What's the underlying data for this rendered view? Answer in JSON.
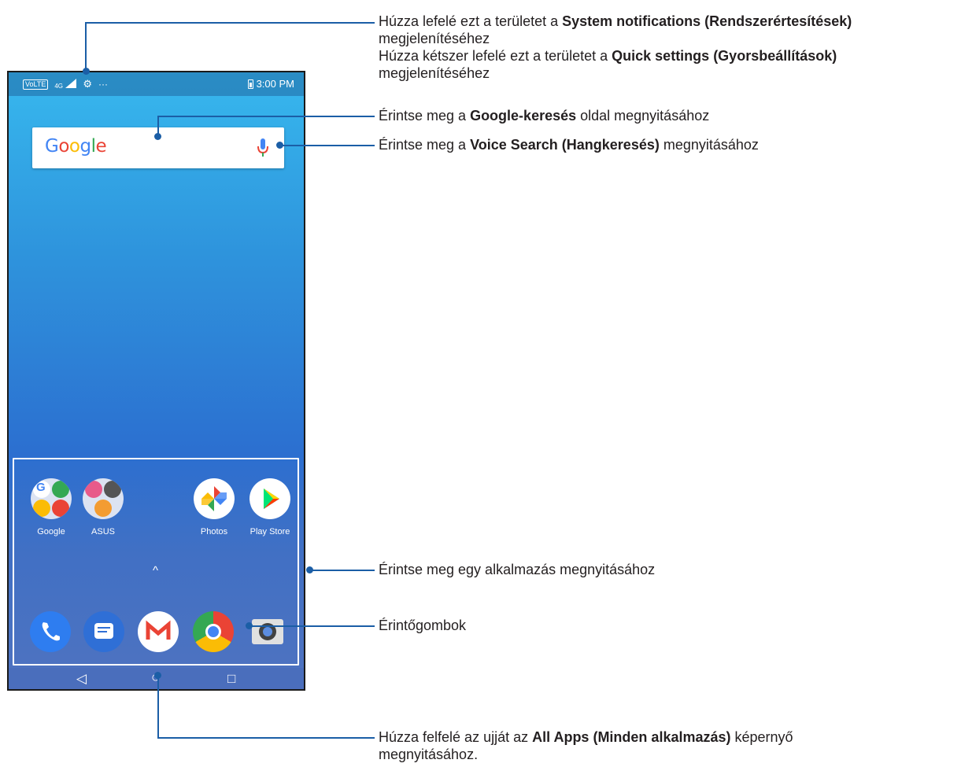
{
  "statusbar": {
    "volte": "VoLTE",
    "network": "4G",
    "more": "···",
    "time": "3:00 PM"
  },
  "search": {
    "logo": "Google",
    "mic_icon": "mic-icon"
  },
  "apps": [
    {
      "label": "Google"
    },
    {
      "label": "ASUS"
    },
    {
      "label": "Photos"
    },
    {
      "label": "Play Store"
    }
  ],
  "dock": [
    "Phone",
    "Messages",
    "Gmail",
    "Chrome",
    "Camera"
  ],
  "drawer_handle": "^",
  "navbar": {
    "back": "◁",
    "home": "○",
    "recents": "□"
  },
  "callouts": {
    "notif_line1_pre": "Húzza lefelé ezt a területet a ",
    "notif_line1_bold": "System notifications (Rendszerértesítések)",
    "notif_line2": "megjelenítéséhez",
    "quick_line1_pre": "Húzza kétszer lefelé ezt a területet a ",
    "quick_line1_bold": "Quick settings (Gyorsbeállítások)",
    "quick_line2": "megjelenítéséhez",
    "google_pre": "Érintse meg a ",
    "google_bold": "Google-keresés",
    "google_post": " oldal megnyitásához",
    "voice_pre": "Érintse meg a ",
    "voice_bold": "Voice Search (Hangkeresés)",
    "voice_post": " megnyitásához",
    "app": "Érintse meg egy alkalmazás megnyitásához",
    "touch": "Érintőgombok",
    "allapps_pre": "Húzza felfelé az ujját az ",
    "allapps_bold": "All Apps (Minden alkalmazás)",
    "allapps_post": " képernyő",
    "allapps_line2": "megnyitásához."
  },
  "colors": {
    "callout_line": "#1b5ea6"
  }
}
